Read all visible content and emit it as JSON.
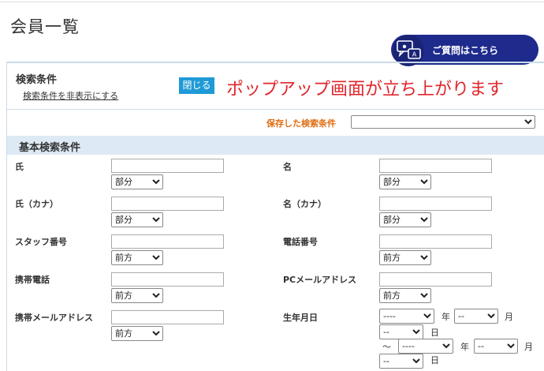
{
  "page": {
    "title": "会員一覧"
  },
  "help": {
    "label": "ご質問はこちら"
  },
  "search": {
    "title": "検索条件",
    "hide_link": "検索条件を非表示にする",
    "close_label": "閉じる",
    "popup_note": "ポップアップ画面が立ち上がります",
    "saved_label": "保存した検索条件",
    "saved_value": ""
  },
  "basic": {
    "title": "基本検索条件",
    "fields": {
      "last_name": {
        "label": "氏",
        "mode": "部分"
      },
      "first_name": {
        "label": "名",
        "mode": "部分"
      },
      "last_kana": {
        "label": "氏（カナ）",
        "mode": "部分"
      },
      "first_kana": {
        "label": "名（カナ）",
        "mode": "部分"
      },
      "staff_no": {
        "label": "スタッフ番号",
        "mode": "前方"
      },
      "phone": {
        "label": "電話番号",
        "mode": "前方"
      },
      "mobile": {
        "label": "携帯電話",
        "mode": "前方"
      },
      "pc_mail": {
        "label": "PCメールアドレス",
        "mode": "前方"
      },
      "mobile_mail": {
        "label": "携帯メールアドレス",
        "mode": "前方"
      }
    },
    "birthdate": {
      "label": "生年月日",
      "year_placeholder": "----",
      "month_placeholder": "--",
      "day_placeholder": "--",
      "year_unit": "年",
      "month_unit": "月",
      "day_unit": "日",
      "range_sep": "〜"
    }
  },
  "colors": {
    "accent": "#1e2a8c",
    "close": "#1f9ad6",
    "note": "#e0252b",
    "saved": "#e06d14",
    "section_bg": "#dde9f4"
  },
  "icons": {
    "help": "chat-person-icon"
  }
}
